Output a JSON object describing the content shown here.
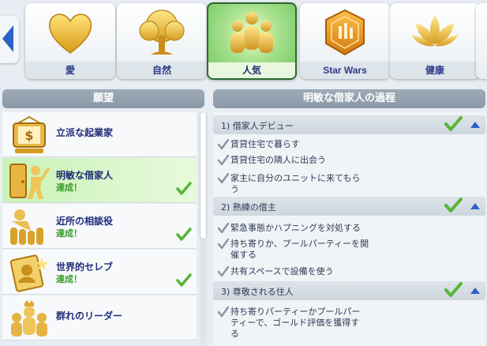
{
  "categories": [
    {
      "label": "愛",
      "icon": "heart-icon"
    },
    {
      "label": "自然",
      "icon": "tree-icon"
    },
    {
      "label": "人気",
      "icon": "people-icon",
      "selected": true
    },
    {
      "label": "Star Wars",
      "icon": "star-wars-badge-icon"
    },
    {
      "label": "健康",
      "icon": "lotus-icon"
    }
  ],
  "left_panel": {
    "title": "願望"
  },
  "right_panel": {
    "title": "明敏な借家人の過程"
  },
  "aspirations": [
    {
      "name": "立派な起業家",
      "status": "",
      "icon": "entrepreneur-icon"
    },
    {
      "name": "明敏な借家人",
      "status": "達成！",
      "icon": "tenant-icon",
      "selected": true
    },
    {
      "name": "近所の相談役",
      "status": "達成！",
      "icon": "neighborhood-confidante-icon"
    },
    {
      "name": "世界的セレブ",
      "status": "達成！",
      "icon": "celebrity-icon"
    },
    {
      "name": "群れのリーダー",
      "status": "",
      "icon": "leader-of-pack-icon"
    }
  ],
  "milestones": [
    {
      "title": "1)  借家人デビュー",
      "goals": [
        "賃貸住宅で暮らす",
        "賃貸住宅の隣人に出会う",
        "家主に自分のユニットに来てもらう"
      ]
    },
    {
      "title": "2)  熟練の借主",
      "goals": [
        "緊急事態かハプニングを対処する",
        "持ち寄りか、プールパーティーを開催する",
        "共有スペースで設備を使う"
      ]
    },
    {
      "title": "3)  尊敬される住人",
      "goals": [
        "持ち寄りパーティーかプールパーティーで、ゴールド評価を獲得する"
      ]
    }
  ],
  "colors": {
    "accent_green": "#56b536",
    "label_blue": "#2d3a86",
    "check_gray": "#8c959e"
  }
}
